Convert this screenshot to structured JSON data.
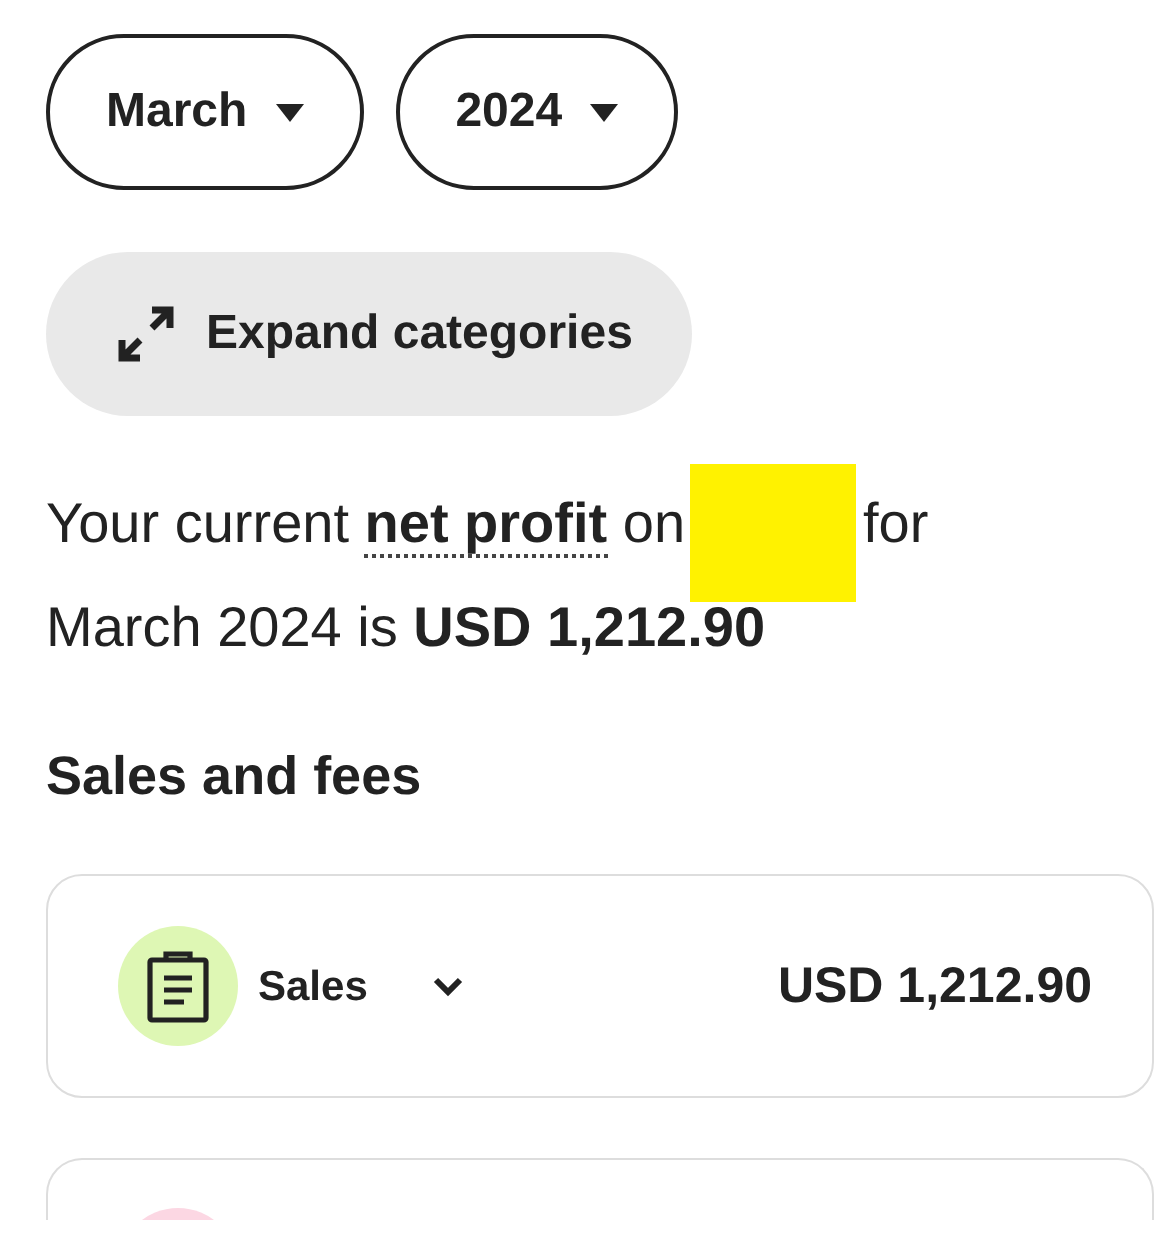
{
  "filters": [
    {
      "label": "March"
    },
    {
      "label": "2024"
    }
  ],
  "expand_button": {
    "label": "Expand categories"
  },
  "summary": {
    "before": "Your current **net profit** on",
    "redacted": true,
    "after": "for",
    "line_2": "March 2024 is **USD 1,212.90**"
  },
  "section_title": "Sales and fees",
  "categories": [
    {
      "kind": "sales",
      "label": "Sales",
      "amount": "USD 1,212.90",
      "color": "#def7b4"
    },
    {
      "kind": "other",
      "color": "#fcd7e3"
    }
  ]
}
